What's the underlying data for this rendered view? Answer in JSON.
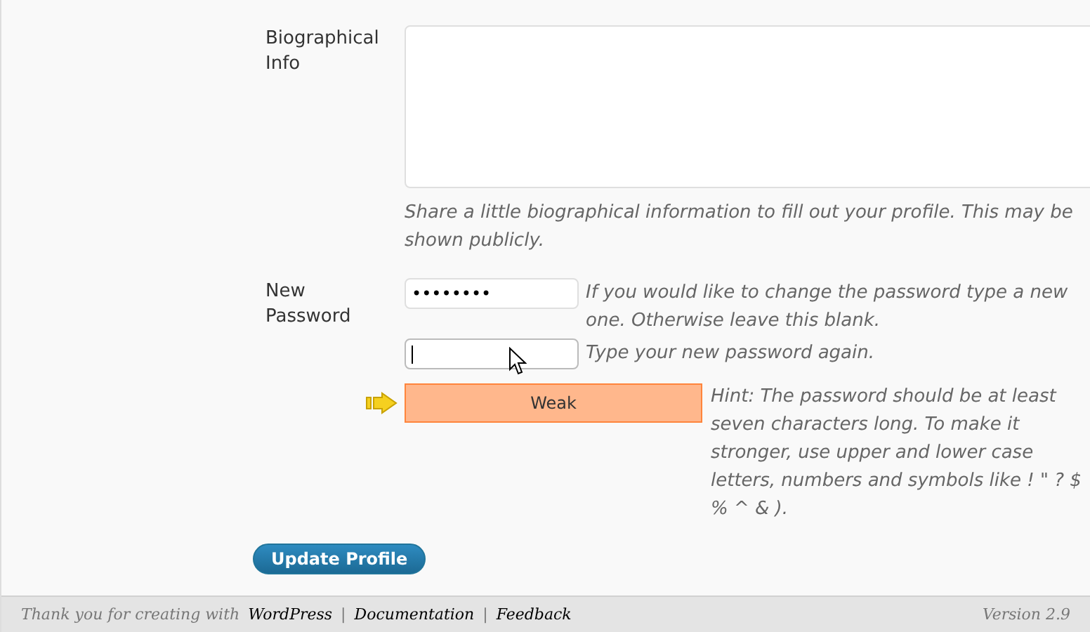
{
  "bio": {
    "label": "Biographical Info",
    "description": "Share a little biographical information to fill out your profile. This may be shown publicly."
  },
  "password": {
    "label": "New Password",
    "value": "••••••••",
    "description": "If you would like to change the password type a new one. Otherwise leave this blank.",
    "confirm_focused": true,
    "confirm_description": "Type your new password again.",
    "strength": {
      "label": "Weak",
      "kind": "weak"
    },
    "hint": "Hint: The password should be at least seven characters long. To make it stronger, use upper and lower case letters, numbers and symbols like ! \" ? $ % ^ & )."
  },
  "submit": "Update Profile",
  "footer": {
    "thanks": "Thank you for creating with",
    "link": "WordPress",
    "separator_1": "|",
    "documentation": "Documentation",
    "separator_2": "|",
    "feedback": "Feedback",
    "version": "Version 2.9"
  }
}
